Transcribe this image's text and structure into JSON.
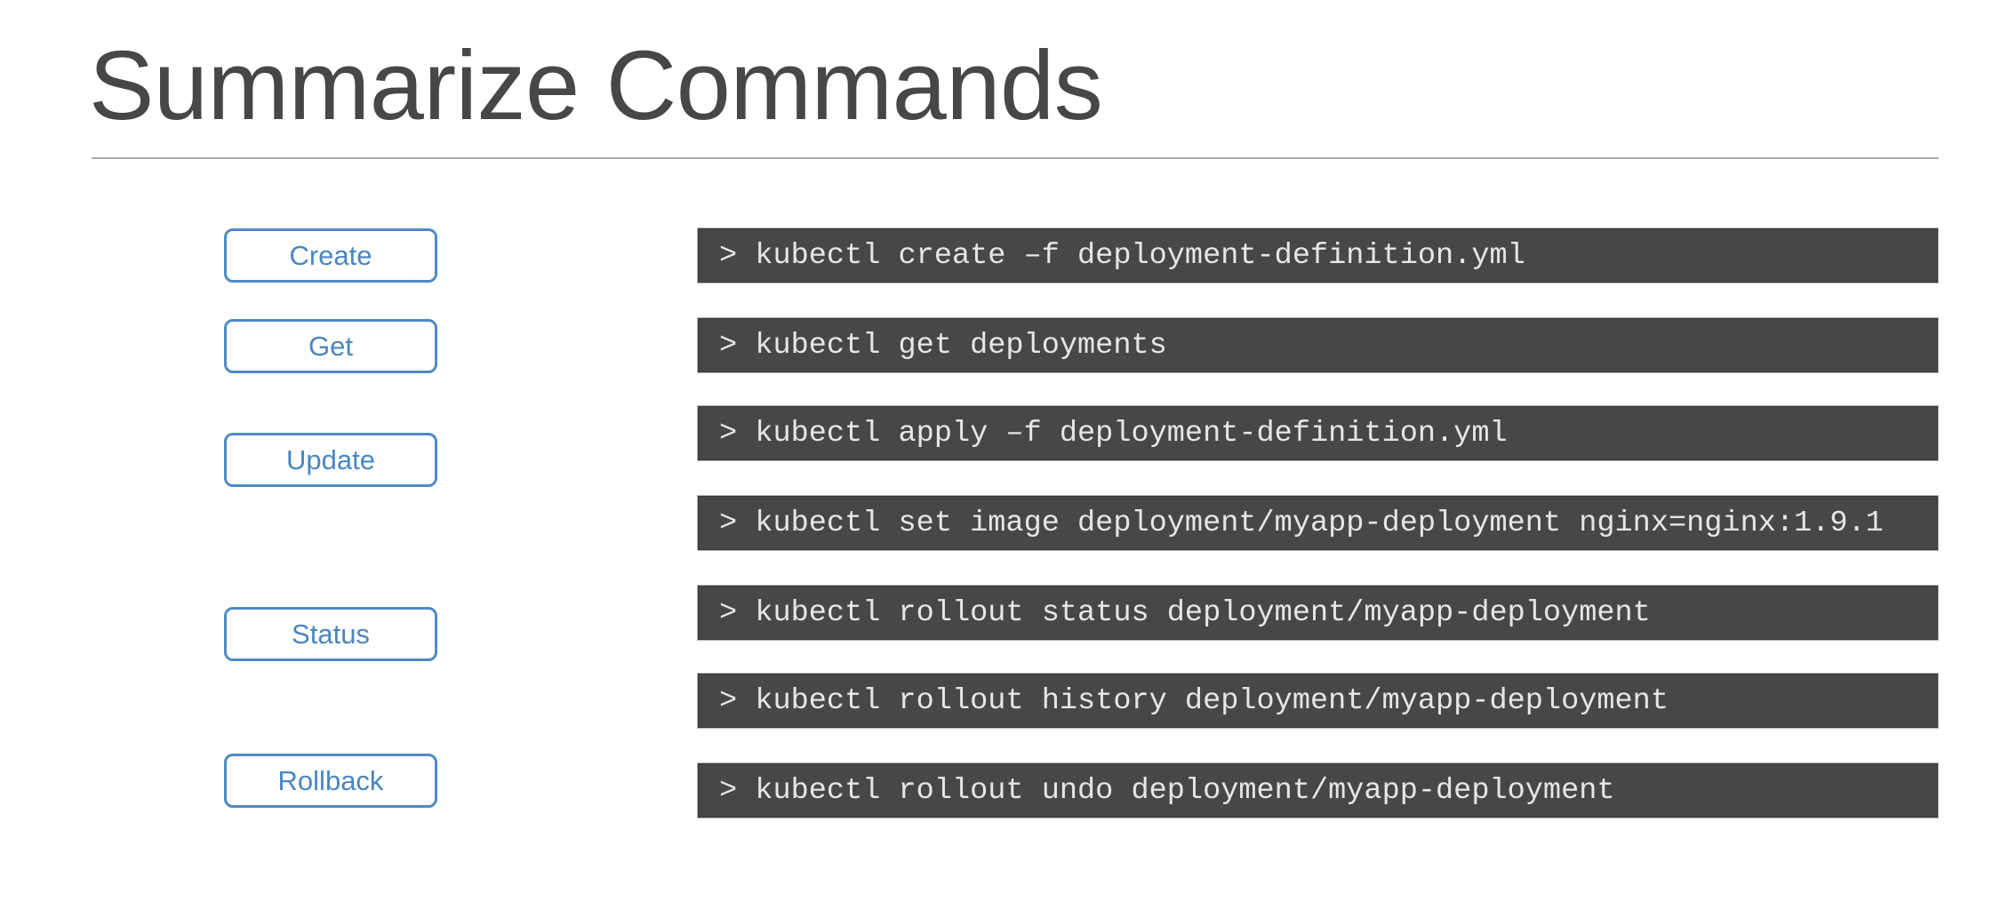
{
  "slide": {
    "title": "Summarize Commands"
  },
  "colors": {
    "title_text": "#474747",
    "button_border": "#4f8ac6",
    "button_text": "#4a86c0",
    "command_bar_background": "#474747",
    "command_text": "#e6e6e6",
    "rule": "#ababab"
  },
  "actions": [
    {
      "label": "Create"
    },
    {
      "label": "Get"
    },
    {
      "label": "Update"
    },
    {
      "label": "Status"
    },
    {
      "label": "Rollback"
    }
  ],
  "commands": [
    {
      "prompt": ">",
      "text": "kubectl create –f deployment-definition.yml",
      "action": "Create"
    },
    {
      "prompt": ">",
      "text": "kubectl get deployments",
      "action": "Get"
    },
    {
      "prompt": ">",
      "text": "kubectl apply –f deployment-definition.yml",
      "action": "Update"
    },
    {
      "prompt": ">",
      "text": "kubectl set image deployment/myapp-deployment nginx=nginx:1.9.1",
      "action": "Update"
    },
    {
      "prompt": ">",
      "text": "kubectl rollout status deployment/myapp-deployment",
      "action": "Status"
    },
    {
      "prompt": ">",
      "text": "kubectl rollout history deployment/myapp-deployment",
      "action": "Status"
    },
    {
      "prompt": ">",
      "text": "kubectl rollout undo deployment/myapp-deployment",
      "action": "Rollback"
    }
  ]
}
